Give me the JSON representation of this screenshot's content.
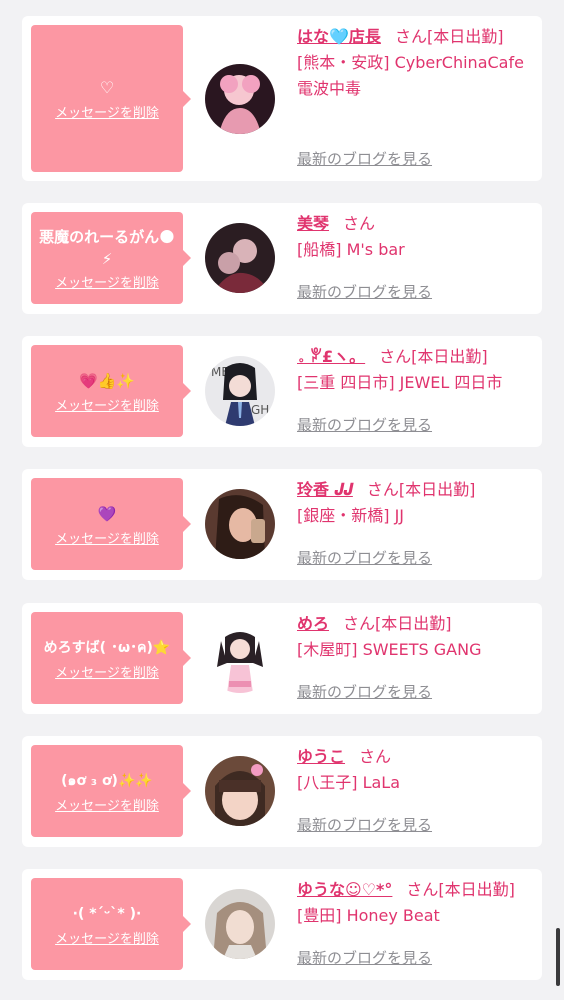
{
  "delete_label": "メッセージを削除",
  "blog_label": "最新のブログを見る",
  "honorific": "さん",
  "cards": [
    {
      "message": "♡",
      "name": "はな🩵店長",
      "tag": "[本日出勤]",
      "shop": "[熊本・安政] CyberChinaCafe 電波中毒"
    },
    {
      "message": "悪魔のれーるがん🌑⚡",
      "name": "美琴",
      "tag": "",
      "shop": "[船橋] M's bar"
    },
    {
      "message": "💗👍✨",
      "name": "。ꐕ£ヽ。",
      "tag": "[本日出勤]",
      "shop": "[三重 四日市] JEWEL 四日市"
    },
    {
      "message": "💜",
      "name": "玲香 𝑱𝑱",
      "tag": "[本日出勤]",
      "shop": "[銀座・新橋] JJ"
    },
    {
      "message": "めろすば( ･ω･ค)⭐",
      "name": "めろ",
      "tag": "[本日出勤]",
      "shop": "[木屋町] SWEETS GANG"
    },
    {
      "message": "(๑ơ ₃ ơ)✨✨",
      "name": "ゆうこ",
      "tag": "",
      "shop": "[八王子] LaLa"
    },
    {
      "message": "·( *ˊᵕˋ* )·",
      "name": "ゆうな☺︎♡*°",
      "tag": "[本日出勤]",
      "shop": "[豊田] Honey Beat"
    }
  ],
  "colors": {
    "accent": "#e0346e",
    "bubble": "#fc97a3",
    "link_gray": "#8e8e93",
    "bg": "#f2f2f4"
  }
}
